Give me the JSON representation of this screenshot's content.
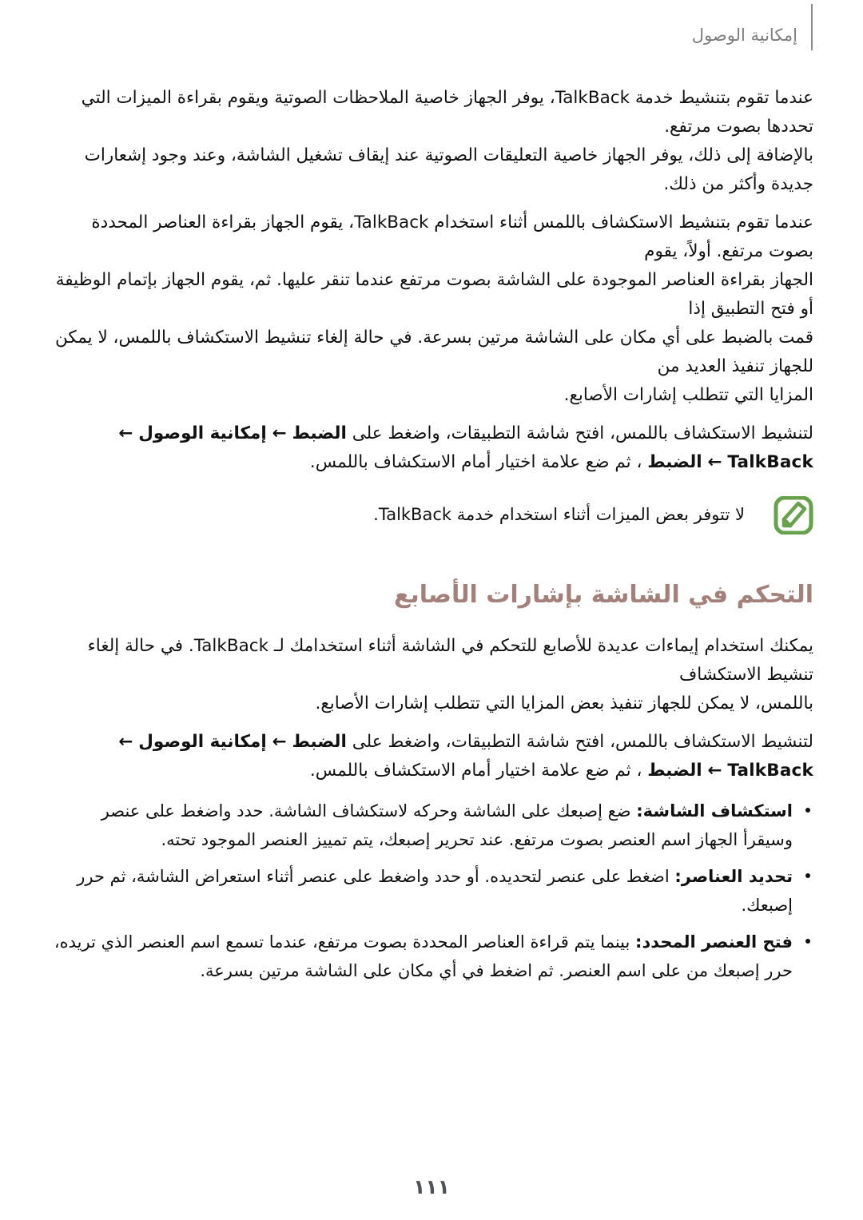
{
  "header": {
    "title": "إمكانية الوصول",
    "rule_color": "#8a8a8a",
    "title_color": "#7d7d7d"
  },
  "body": {
    "paragraphs": [
      {
        "id": "talkback-intro",
        "lines": [
          "عندما تقوم بتنشيط خدمة TalkBack، يوفر الجهاز خاصية الملاحظات الصوتية ويقوم بقراءة الميزات التي تحددها بصوت مرتفع.",
          "بالإضافة إلى ذلك، يوفر الجهاز خاصية التعليقات الصوتية عند إيقاف تشغيل الشاشة، وعند وجود إشعارات جديدة وأكثر من ذلك."
        ]
      },
      {
        "id": "explore-by-touch",
        "lines": [
          "عندما تقوم بتنشيط الاستكشاف باللمس أثناء استخدام TalkBack، يقوم الجهاز بقراءة العناصر المحددة بصوت مرتفع. أولاً، يقوم",
          "الجهاز بقراءة العناصر الموجودة على الشاشة بصوت مرتفع عندما تنقر عليها. ثم، يقوم الجهاز بإتمام الوظيفة أو فتح التطبيق إذا",
          "قمت بالضبط على أي مكان على الشاشة مرتين بسرعة. في حالة إلغاء تنشيط الاستكشاف باللمس، لا يمكن للجهاز تنفيذ العديد من",
          "المزايا التي تتطلب إشارات الأصابع."
        ]
      }
    ],
    "nav_paths": [
      {
        "id": "nav-path-explore-by-touch",
        "lead": "لتنشيط الاستكشاف باللمس، افتح شاشة التطبيقات، واضغط على",
        "steps": [
          "الضبط",
          "إمكانية الوصول",
          "TalkBack",
          "الضبط"
        ],
        "arrow": "←",
        "tail": "، ثم ضع علامة اختيار أمام الاستكشاف باللمس."
      }
    ],
    "note": {
      "icon_name": "note-pencil-icon",
      "icon_color": "#68a14b",
      "text": "لا تتوفر بعض الميزات أثناء استخدام خدمة TalkBack."
    },
    "section": {
      "heading": "التحكم في الشاشة بإشارات الأصابع",
      "heading_color": "#a4807a",
      "paragraphs": [
        {
          "id": "finger-gestures-intro",
          "lines": [
            "يمكنك استخدام إيماءات عديدة للأصابع للتحكم في الشاشة أثناء استخدامك لـ TalkBack. في حالة إلغاء تنشيط الاستكشاف",
            "باللمس، لا يمكن للجهاز تنفيذ بعض المزايا التي تتطلب إشارات الأصابع."
          ]
        }
      ],
      "nav_path": {
        "id": "nav-path-gestures",
        "lead": "لتنشيط الاستكشاف باللمس، افتح شاشة التطبيقات، واضغط على",
        "steps": [
          "الضبط",
          "إمكانية الوصول",
          "TalkBack",
          "الضبط"
        ],
        "arrow": "←",
        "tail": "، ثم ضع علامة اختيار أمام الاستكشاف باللمس."
      },
      "bullets": [
        {
          "id": "bullet-explore-screen",
          "label": "استكشاف الشاشة:",
          "text": "ضع إصبعك على الشاشة وحركه لاستكشاف الشاشة. حدد واضغط على عنصر وسيقرأ الجهاز اسم العنصر بصوت مرتفع. عند تحرير إصبعك، يتم تمييز العنصر الموجود تحته."
        },
        {
          "id": "bullet-select-items",
          "label": "تحديد العناصر:",
          "text": "اضغط على عنصر لتحديده. أو حدد واضغط على عنصر أثناء استعراض الشاشة، ثم حرر إصبعك."
        },
        {
          "id": "bullet-open-selected-item",
          "label": "فتح العنصر المحدد:",
          "text": "بينما يتم قراءة العناصر المحددة بصوت مرتفع، عندما تسمع اسم العنصر الذي تريده، حرر إصبعك من على اسم العنصر. ثم اضغط في أي مكان على الشاشة مرتين بسرعة."
        }
      ]
    }
  },
  "footer": {
    "page_number": "١١١"
  }
}
